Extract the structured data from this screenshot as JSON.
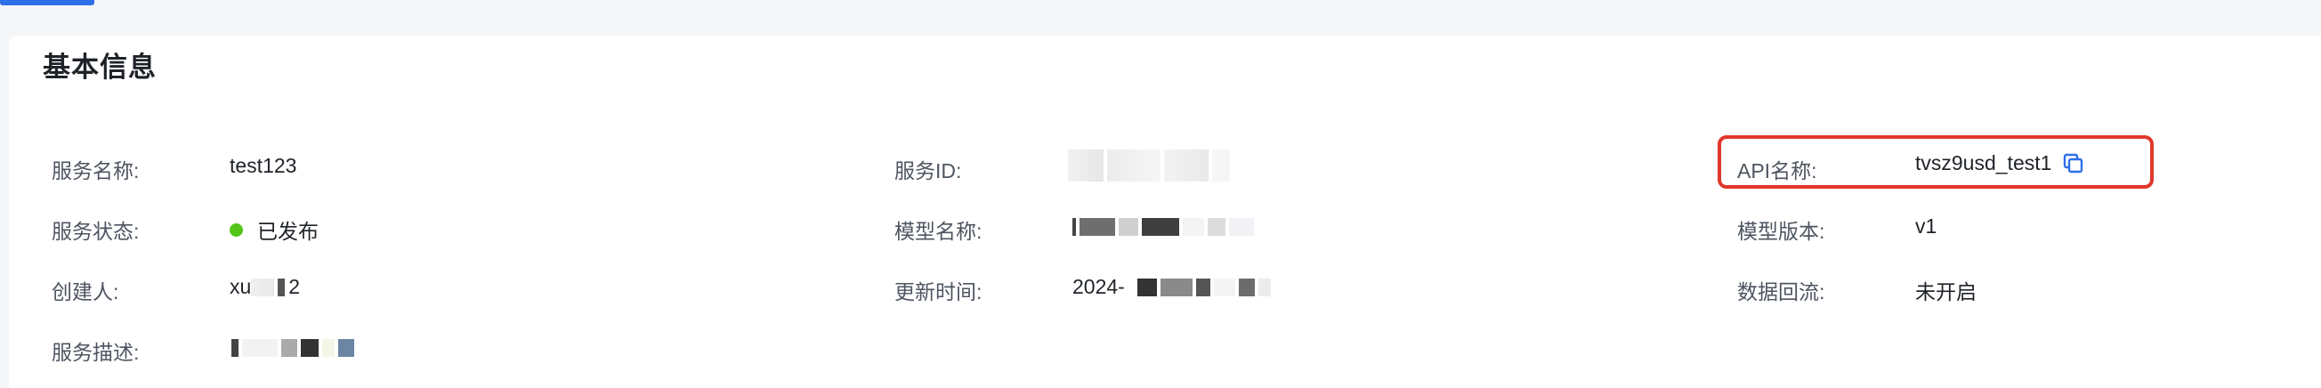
{
  "section": {
    "title": "基本信息"
  },
  "fields": {
    "service_name": {
      "label": "服务名称:",
      "value": "test123"
    },
    "service_status": {
      "label": "服务状态:",
      "value": "已发布",
      "dot_color": "#52c41a"
    },
    "creator": {
      "label": "创建人:",
      "value_prefix": "xu",
      "value_suffix": "2"
    },
    "service_desc": {
      "label": "服务描述:"
    },
    "service_id": {
      "label": "服务ID:"
    },
    "model_name": {
      "label": "模型名称:"
    },
    "update_time": {
      "label": "更新时间:",
      "value_prefix": "2024-"
    },
    "api_name": {
      "label": "API名称:",
      "value": "tvsz9usd_test1",
      "icon": "copy-icon"
    },
    "model_version": {
      "label": "模型版本:",
      "value": "v1"
    },
    "data_backflow": {
      "label": "数据回流:",
      "value": "未开启"
    }
  },
  "colors": {
    "accent": "#2f6fe8",
    "highlight": "#e0382c",
    "status_published": "#52c41a"
  }
}
